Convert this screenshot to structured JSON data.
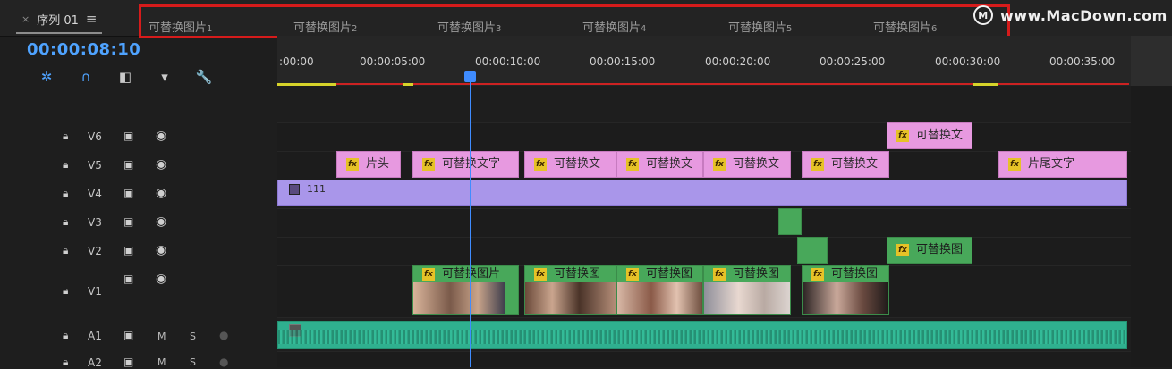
{
  "sequence_tab": {
    "close": "×",
    "title": "序列 01",
    "menu": "≡"
  },
  "sequence_tabs": [
    {
      "label": "可替换图片",
      "num": "1"
    },
    {
      "label": "可替换图片",
      "num": "2"
    },
    {
      "label": "可替换图片",
      "num": "3"
    },
    {
      "label": "可替换图片",
      "num": "4"
    },
    {
      "label": "可替换图片",
      "num": "5"
    },
    {
      "label": "可替换图片",
      "num": "6"
    }
  ],
  "watermark": {
    "logo": "M",
    "text": "www.MacDown.com"
  },
  "timecode": "00:00:08:10",
  "tools": [
    {
      "icon": "snap-icon",
      "glyph": "✲"
    },
    {
      "icon": "linked-selection-icon",
      "glyph": "∩"
    },
    {
      "icon": "add-marker-icon",
      "glyph": "◧"
    },
    {
      "icon": "marker-icon",
      "glyph": "▾"
    },
    {
      "icon": "wrench-icon",
      "glyph": "🔧"
    }
  ],
  "ruler": {
    "ticks": [
      ":00:00",
      "00:00:05:00",
      "00:00:10:00",
      "00:00:15:00",
      "00:00:20:00",
      "00:00:25:00",
      "00:00:30:00",
      "00:00:35:00"
    ]
  },
  "tracks": {
    "V6": {
      "name": "V6",
      "clips": [
        {
          "label": "可替换文"
        }
      ]
    },
    "V5": {
      "name": "V5",
      "clips": [
        {
          "label": "片头"
        },
        {
          "label": "可替换文字"
        },
        {
          "label": "可替换文"
        },
        {
          "label": "可替换文"
        },
        {
          "label": "可替换文"
        },
        {
          "label": "可替换文"
        },
        {
          "label": "片尾文字"
        }
      ]
    },
    "V4": {
      "name": "V4",
      "clips": [
        {
          "label": "111"
        }
      ]
    },
    "V3": {
      "name": "V3"
    },
    "V2": {
      "name": "V2",
      "clips": [
        {
          "label": "可替换图"
        }
      ]
    },
    "V1": {
      "name": "V1",
      "clips": [
        {
          "label": "可替换图片"
        },
        {
          "label": "可替换图"
        },
        {
          "label": "可替换图"
        },
        {
          "label": "可替换图"
        },
        {
          "label": "可替换图"
        }
      ]
    },
    "A1": {
      "name": "A1",
      "m": "M",
      "s": "S"
    },
    "A2": {
      "name": "A2",
      "m": "M",
      "s": "S"
    }
  },
  "colors": {
    "title_clip": "#e799e0",
    "purple_clip": "#a996ea",
    "green_clip": "#48a85a",
    "audio_clip": "#2fb08f",
    "playhead": "#3f8cff",
    "highlight": "#d61b1b"
  }
}
